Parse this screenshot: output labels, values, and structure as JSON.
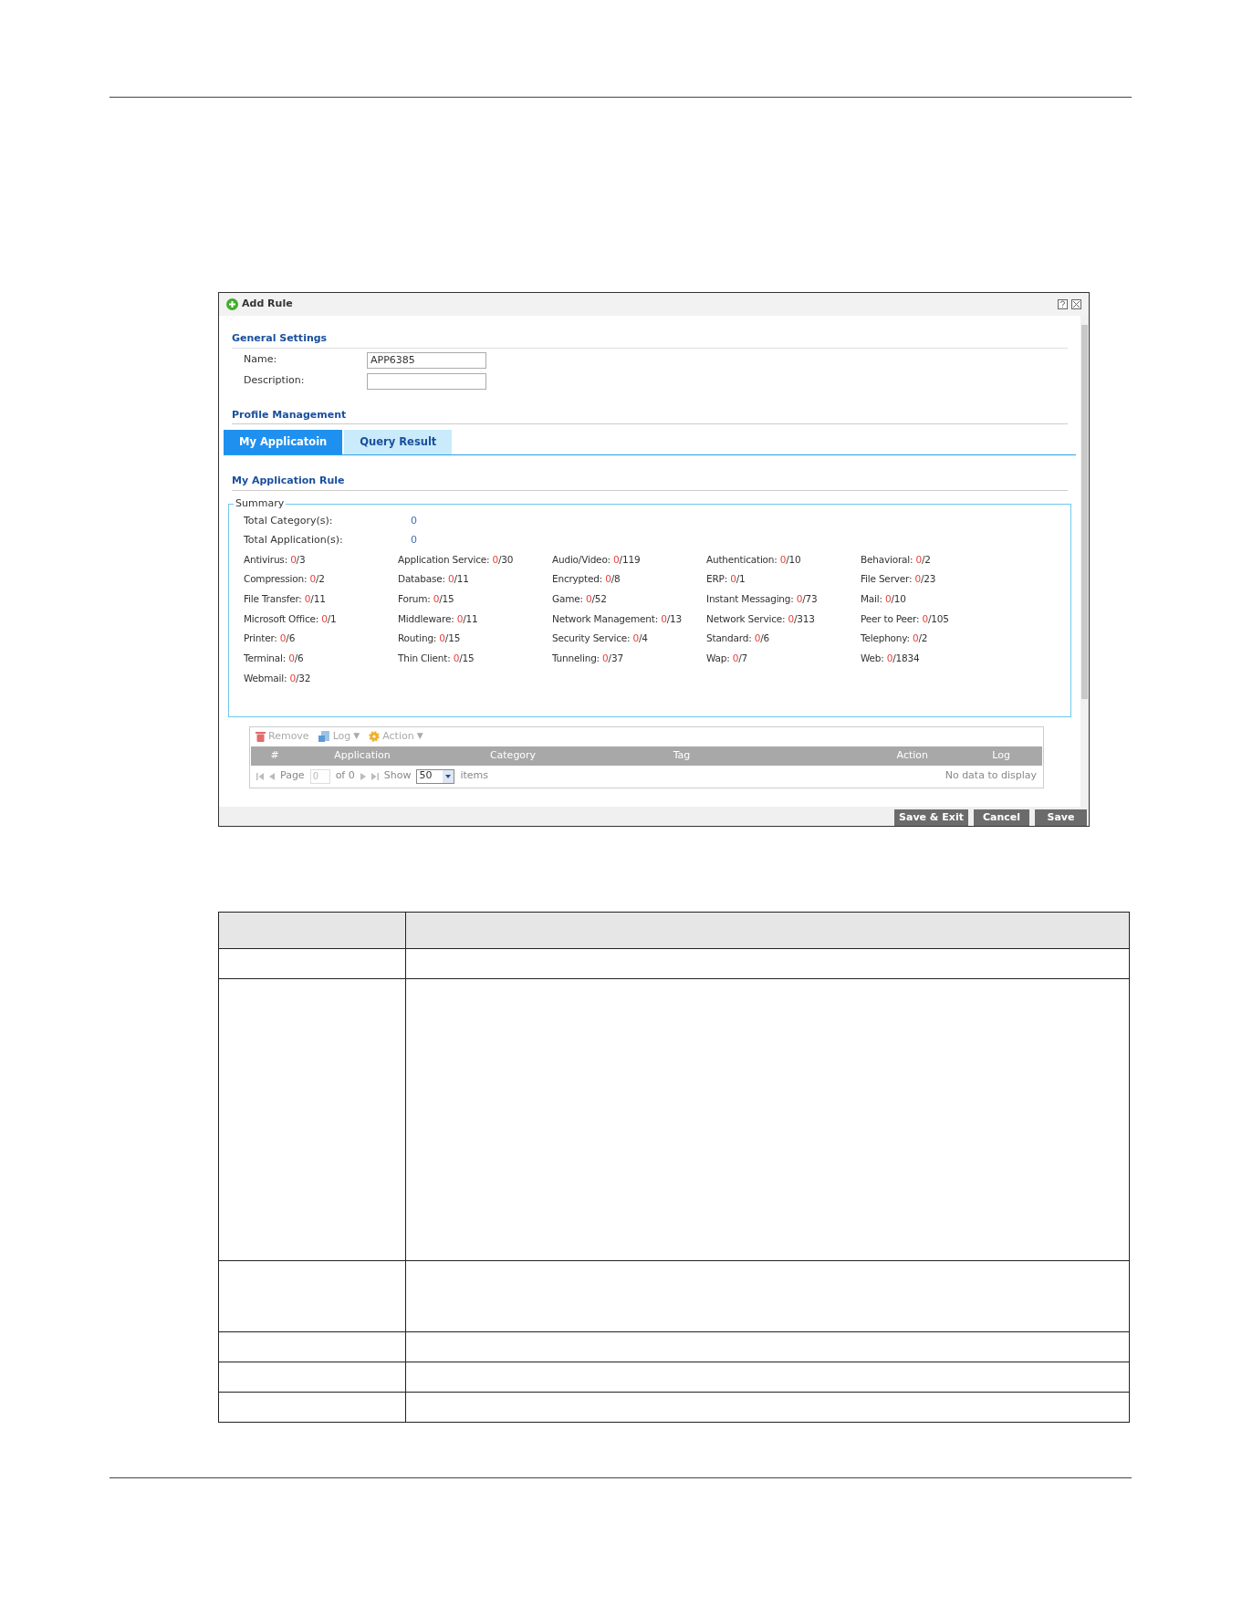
{
  "dialog": {
    "title": "Add Rule",
    "general_settings": {
      "heading": "General Settings",
      "fields": [
        {
          "label": "Name:",
          "value": "APP6385"
        },
        {
          "label": "Description:"
        }
      ]
    },
    "profile_management": {
      "heading": "Profile Management"
    },
    "tabs": [
      {
        "label": "My Applicatoin",
        "selected": true
      },
      {
        "label": "Query Result",
        "selected": false
      }
    ],
    "rule_heading": "My Application Rule",
    "summary": {
      "legend": "Summary",
      "totals": [
        {
          "label": "Total Category(s):",
          "value": "0"
        },
        {
          "label": "Total Application(s):",
          "value": "0"
        }
      ],
      "categories": [
        {
          "label": "Antivirus:",
          "count": "0",
          "total": "/3"
        },
        {
          "label": "Application Service:",
          "count": "0",
          "total": "/30"
        },
        {
          "label": "Audio/Video:",
          "count": "0",
          "total": "/119"
        },
        {
          "label": "Authentication:",
          "count": "0",
          "total": "/10"
        },
        {
          "label": "Behavioral:",
          "count": "0",
          "total": "/2"
        },
        {
          "label": "Compression:",
          "count": "0",
          "total": "/2"
        },
        {
          "label": "Database:",
          "count": "0",
          "total": "/11"
        },
        {
          "label": "Encrypted:",
          "count": "0",
          "total": "/8"
        },
        {
          "label": "ERP:",
          "count": "0",
          "total": "/1"
        },
        {
          "label": "File Server:",
          "count": "0",
          "total": "/23"
        },
        {
          "label": "File Transfer:",
          "count": "0",
          "total": "/11"
        },
        {
          "label": "Forum:",
          "count": "0",
          "total": "/15"
        },
        {
          "label": "Game:",
          "count": "0",
          "total": "/52"
        },
        {
          "label": "Instant Messaging:",
          "count": "0",
          "total": "/73"
        },
        {
          "label": "Mail:",
          "count": "0",
          "total": "/10"
        },
        {
          "label": "Microsoft Office:",
          "count": "0",
          "total": "/1"
        },
        {
          "label": "Middleware:",
          "count": "0",
          "total": "/11"
        },
        {
          "label": "Network Management:",
          "count": "0",
          "total": "/13"
        },
        {
          "label": "Network Service:",
          "count": "0",
          "total": "/313"
        },
        {
          "label": "Peer to Peer:",
          "count": "0",
          "total": "/105"
        },
        {
          "label": "Printer:",
          "count": "0",
          "total": "/6"
        },
        {
          "label": "Routing:",
          "count": "0",
          "total": "/15"
        },
        {
          "label": "Security Service:",
          "count": "0",
          "total": "/4"
        },
        {
          "label": "Standard:",
          "count": "0",
          "total": "/6"
        },
        {
          "label": "Telephony:",
          "count": "0",
          "total": "/2"
        },
        {
          "label": "Terminal:",
          "count": "0",
          "total": "/6"
        },
        {
          "label": "Thin Client:",
          "count": "0",
          "total": "/15"
        },
        {
          "label": "Tunneling:",
          "count": "0",
          "total": "/37"
        },
        {
          "label": "Wap:",
          "count": "0",
          "total": "/7"
        },
        {
          "label": "Web:",
          "count": "0",
          "total": "/1834"
        },
        {
          "label": "Webmail:",
          "count": "0",
          "total": "/32"
        }
      ]
    },
    "toolbar": [
      {
        "kind": "remove",
        "label": "Remove",
        "menu": false
      },
      {
        "kind": "log",
        "label": "Log",
        "menu": true
      },
      {
        "kind": "action",
        "label": "Action",
        "menu": true
      }
    ],
    "menu_caret": "▼",
    "grid_columns": [
      "#",
      "Application",
      "Category",
      "Tag",
      "Action",
      "Log"
    ],
    "pager": {
      "page_label": "Page",
      "page_value": "0",
      "of_label": "of 0",
      "show_label": "Show",
      "page_size": "50",
      "items_label": "items",
      "empty_message": "No data to display"
    },
    "buttons": [
      "Save & Exit",
      "Cancel",
      "Save"
    ]
  }
}
